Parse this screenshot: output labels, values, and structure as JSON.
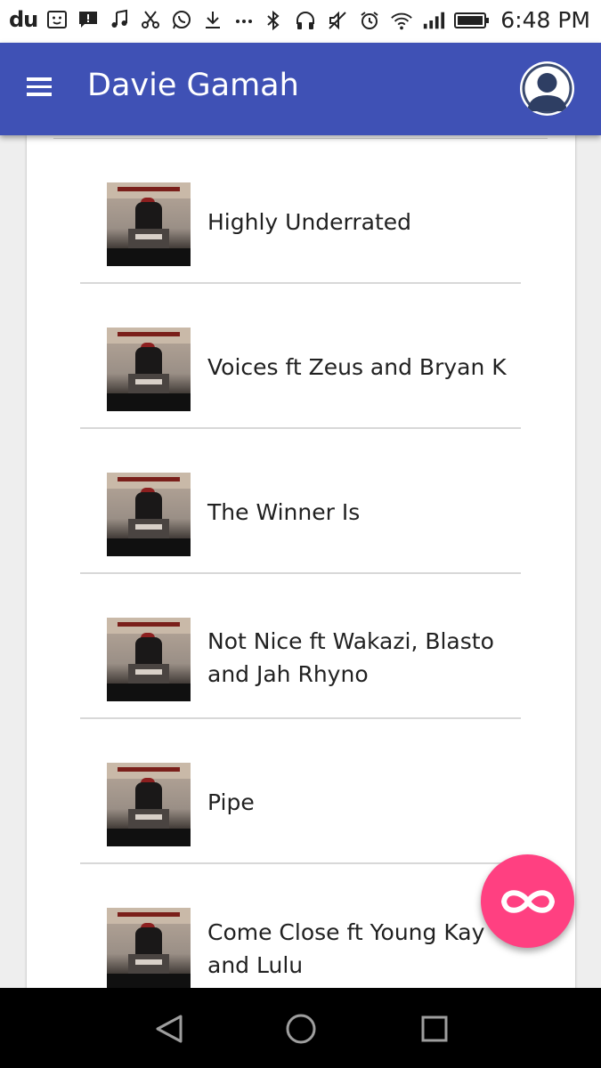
{
  "status_bar": {
    "brand": "du",
    "time": "6:48 PM",
    "icons": [
      "face-icon",
      "alert-icon",
      "music-icon",
      "scissors-icon",
      "whatsapp-icon",
      "download-icon",
      "more-icon",
      "bluetooth-icon",
      "headphones-icon",
      "mute-icon",
      "alarm-icon",
      "wifi-icon",
      "signal-icon",
      "battery-icon"
    ]
  },
  "app_bar": {
    "title": "Davie Gamah",
    "background": "#3f51b5"
  },
  "tracks": [
    {
      "title": "Highly Underrated"
    },
    {
      "title": "Voices ft Zeus and Bryan K"
    },
    {
      "title": "The Winner Is"
    },
    {
      "title": "Not Nice ft Wakazi, Blasto and Jah Rhyno"
    },
    {
      "title": "Pipe"
    },
    {
      "title": "Come Close ft Young Kay and Lulu"
    }
  ],
  "fab": {
    "icon": "infinity-icon",
    "color": "#ff4081"
  },
  "nav_bar": {
    "buttons": [
      "back-icon",
      "home-icon",
      "recents-icon"
    ]
  }
}
